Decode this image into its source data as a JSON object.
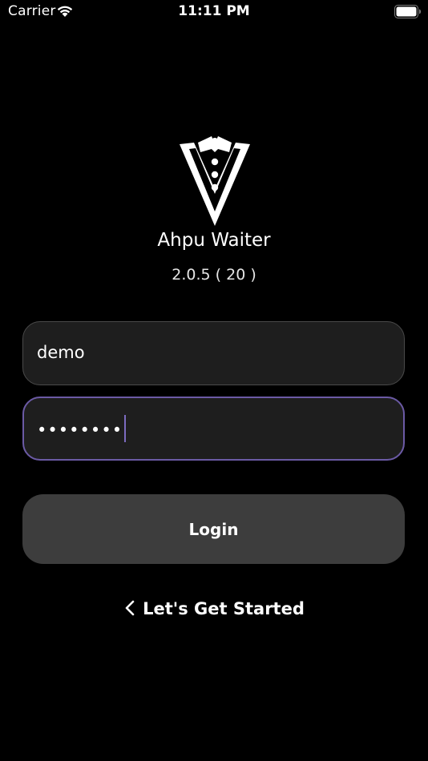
{
  "status_bar": {
    "carrier": "Carrier",
    "time": "11:11 PM"
  },
  "app": {
    "name": "Ahpu Waiter",
    "version": "2.0.5 ( 20 )",
    "icon": "tuxedo-logo-icon"
  },
  "form": {
    "username_value": "demo",
    "password_value": "••••••••",
    "login_label": "Login",
    "back_label": "Let's Get Started"
  },
  "colors": {
    "background": "#000000",
    "field_bg": "#1e1e1e",
    "focus_border": "#6b5aa5",
    "button_bg": "#3d3d3d"
  }
}
